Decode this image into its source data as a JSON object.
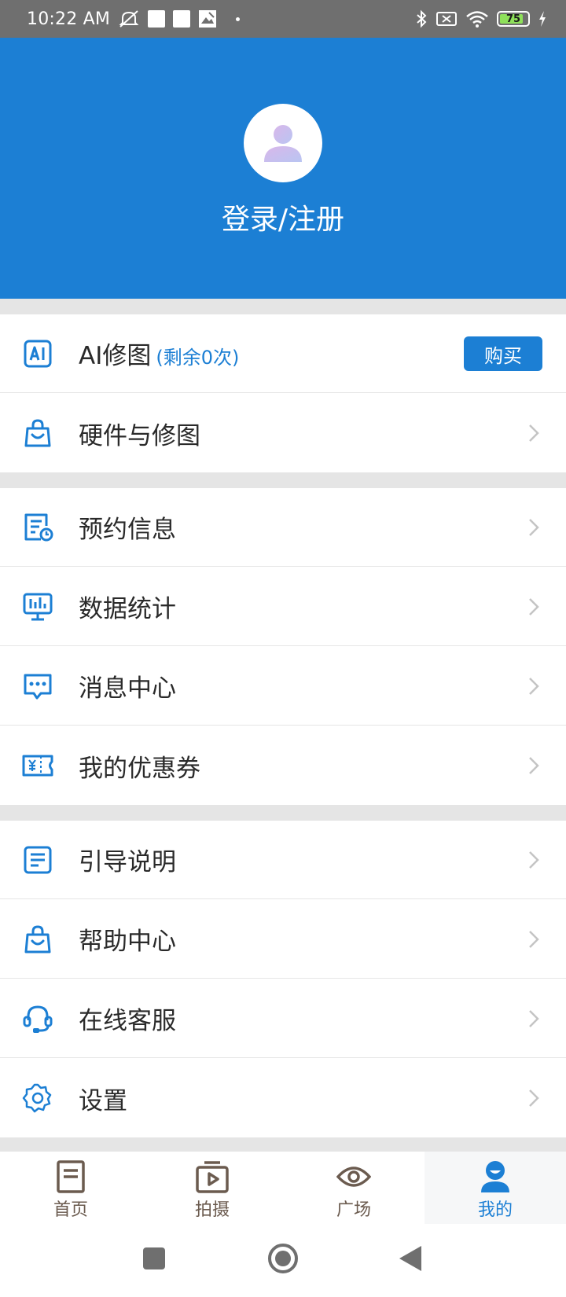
{
  "status_bar": {
    "time": "10:22 AM",
    "battery_level": "75",
    "icons": [
      "mute-icon",
      "notification-box-icon",
      "notification-box-icon",
      "image-icon",
      "dot-icon",
      "bluetooth-icon",
      "no-sim-icon",
      "wifi-icon",
      "battery-icon",
      "charging-icon"
    ]
  },
  "header": {
    "login_label": "登录/注册",
    "background_color": "#1c7fd4"
  },
  "menu": {
    "group1": [
      {
        "icon": "ai-icon",
        "label": "AI修图",
        "sub": "(剩余0次)",
        "button": "购买"
      },
      {
        "icon": "shopping-bag-icon",
        "label": "硬件与修图"
      }
    ],
    "group2": [
      {
        "icon": "appointment-icon",
        "label": "预约信息"
      },
      {
        "icon": "statistics-icon",
        "label": "数据统计"
      },
      {
        "icon": "message-icon",
        "label": "消息中心"
      },
      {
        "icon": "coupon-icon",
        "label": "我的优惠券"
      }
    ],
    "group3": [
      {
        "icon": "guide-icon",
        "label": "引导说明"
      },
      {
        "icon": "help-icon",
        "label": "帮助中心"
      },
      {
        "icon": "headset-icon",
        "label": "在线客服"
      },
      {
        "icon": "settings-icon",
        "label": "设置"
      }
    ]
  },
  "bottom_nav": {
    "items": [
      {
        "icon": "home-icon",
        "label": "首页",
        "active": false
      },
      {
        "icon": "camera-play-icon",
        "label": "拍摄",
        "active": false
      },
      {
        "icon": "eye-icon",
        "label": "广场",
        "active": false
      },
      {
        "icon": "profile-icon",
        "label": "我的",
        "active": true
      }
    ]
  },
  "colors": {
    "accent": "#1c7fd4",
    "nav_inactive": "#6b5b4f",
    "divider": "#e5e5e5"
  }
}
